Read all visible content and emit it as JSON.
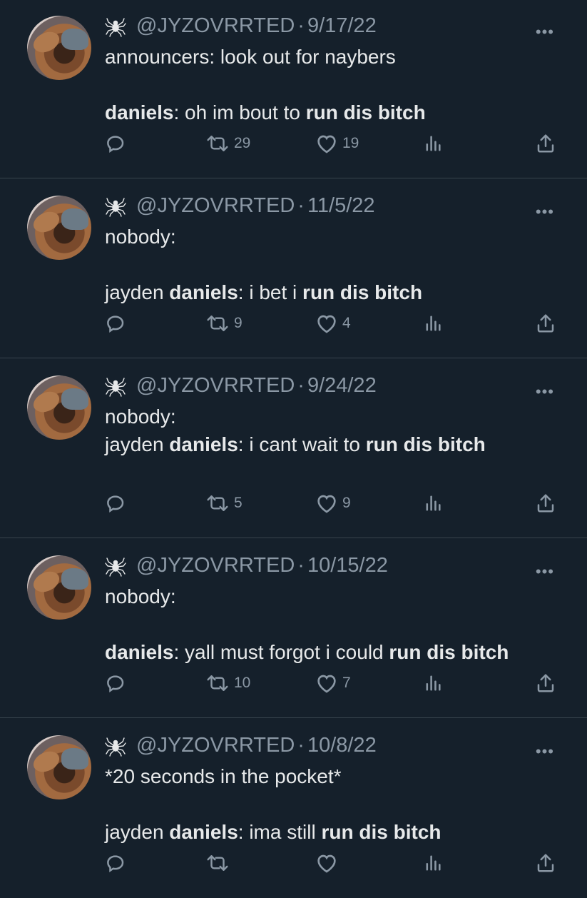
{
  "tweets": [
    {
      "handle": "@JYZOVRRTED",
      "sep": "·",
      "date": "9/17/22",
      "lines": [
        [
          {
            "t": "announcers: look out for naybers",
            "b": false
          }
        ],
        [],
        [
          {
            "t": "daniels",
            "b": true
          },
          {
            "t": ": oh im bout to ",
            "b": false
          },
          {
            "t": "run dis bitch",
            "b": true
          }
        ]
      ],
      "retweets": "29",
      "likes": "19"
    },
    {
      "handle": "@JYZOVRRTED",
      "sep": "·",
      "date": "11/5/22",
      "lines": [
        [
          {
            "t": "nobody:",
            "b": false
          }
        ],
        [],
        [
          {
            "t": "jayden ",
            "b": false
          },
          {
            "t": "daniels",
            "b": true
          },
          {
            "t": ": i bet i ",
            "b": false
          },
          {
            "t": "run dis bitch",
            "b": true
          }
        ]
      ],
      "retweets": "9",
      "likes": "4"
    },
    {
      "handle": "@JYZOVRRTED",
      "sep": "·",
      "date": "9/24/22",
      "lines": [
        [
          {
            "t": "nobody:",
            "b": false
          }
        ],
        [
          {
            "t": "jayden ",
            "b": false
          },
          {
            "t": "daniels",
            "b": true
          },
          {
            "t": ": i cant wait to ",
            "b": false
          },
          {
            "t": "run dis bitch",
            "b": true
          }
        ]
      ],
      "retweets": "5",
      "likes": "9"
    },
    {
      "handle": "@JYZOVRRTED",
      "sep": "·",
      "date": "10/15/22",
      "lines": [
        [
          {
            "t": "nobody:",
            "b": false
          }
        ],
        [],
        [
          {
            "t": "daniels",
            "b": true
          },
          {
            "t": ": yall must forgot i could ",
            "b": false
          },
          {
            "t": "run dis bitch",
            "b": true
          }
        ]
      ],
      "retweets": "10",
      "likes": "7"
    },
    {
      "handle": "@JYZOVRRTED",
      "sep": "·",
      "date": "10/8/22",
      "lines": [
        [
          {
            "t": "*20 seconds in the pocket*",
            "b": false
          }
        ],
        [],
        [
          {
            "t": "jayden ",
            "b": false
          },
          {
            "t": "daniels",
            "b": true
          },
          {
            "t": ": ima still ",
            "b": false
          },
          {
            "t": "run dis bitch",
            "b": true
          }
        ]
      ],
      "retweets": "",
      "likes": ""
    }
  ],
  "icons": {
    "more": "more-dots-icon",
    "reply": "reply-icon",
    "retweet": "retweet-icon",
    "like": "heart-icon",
    "views": "analytics-icon",
    "share": "share-icon",
    "badge": "spider-icon"
  },
  "colors": {
    "background": "#15202b",
    "text": "#e7e9ea",
    "muted": "#8b98a5",
    "divider": "#38444d"
  }
}
